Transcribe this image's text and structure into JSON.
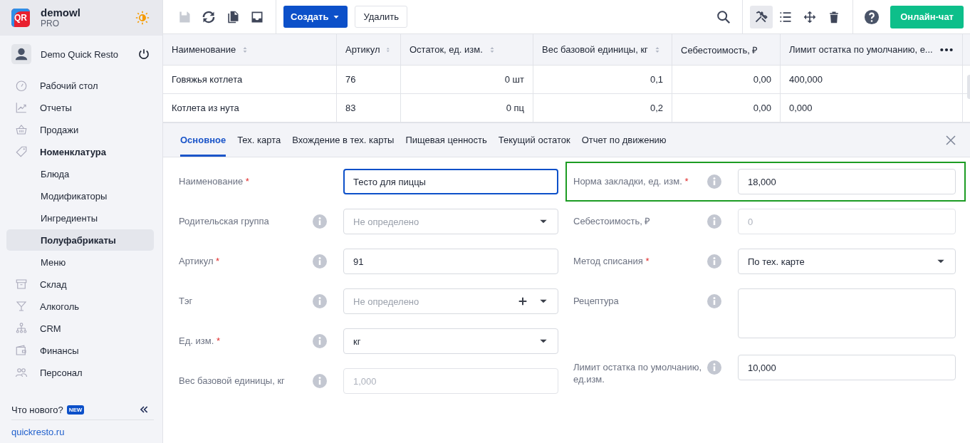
{
  "sidebar": {
    "logo_text": "QR",
    "account": {
      "name": "demowl",
      "plan": "PRO"
    },
    "user": {
      "name": "Demo Quick Resto"
    },
    "items": [
      {
        "label": "Рабочий стол",
        "selected": false,
        "expanded": false
      },
      {
        "label": "Отчеты",
        "selected": false,
        "expanded": false
      },
      {
        "label": "Продажи",
        "selected": false,
        "expanded": false
      },
      {
        "label": "Номенклатура",
        "selected": false,
        "expanded": true,
        "children": [
          {
            "label": "Блюда",
            "selected": false
          },
          {
            "label": "Модификаторы",
            "selected": false
          },
          {
            "label": "Ингредиенты",
            "selected": false
          },
          {
            "label": "Полуфабрикаты",
            "selected": true
          },
          {
            "label": "Меню",
            "selected": false
          }
        ]
      },
      {
        "label": "Склад",
        "selected": false,
        "expanded": false
      },
      {
        "label": "Алкоголь",
        "selected": false,
        "expanded": false
      },
      {
        "label": "CRM",
        "selected": false,
        "expanded": false
      },
      {
        "label": "Финансы",
        "selected": false,
        "expanded": false
      },
      {
        "label": "Персонал",
        "selected": false,
        "expanded": false
      }
    ],
    "whats_new": "Что нового?",
    "new_badge": "NEW",
    "site_link": "quickresto.ru"
  },
  "toolbar": {
    "left_icons": [
      {
        "kind": "save",
        "disabled": true
      },
      {
        "kind": "refresh",
        "disabled": false
      },
      {
        "kind": "copy",
        "disabled": false
      },
      {
        "kind": "inbox",
        "disabled": false
      }
    ],
    "create_button": "Создать",
    "delete_button": "Удалить",
    "right_icons": [
      {
        "kind": "tools",
        "selected": true
      },
      {
        "kind": "list",
        "selected": false
      },
      {
        "kind": "move",
        "selected": false
      },
      {
        "kind": "trash",
        "selected": false
      }
    ],
    "chat_button": "Онлайн-чат"
  },
  "table": {
    "columns": [
      {
        "label": "Наименование",
        "sortable": true
      },
      {
        "label": "Артикул",
        "sortable": true
      },
      {
        "label": "Остаток, ед. изм.",
        "sortable": true
      },
      {
        "label": "Вес базовой единицы, кг",
        "sortable": true
      },
      {
        "label": "Себестоимость, ₽",
        "sortable": false
      },
      {
        "label": "Лимит остатка по умолчанию, е...",
        "sortable": false
      }
    ],
    "rows": [
      [
        "Говяжья котлета",
        "76",
        "0 шт",
        "0,1",
        "0,00",
        "400,000"
      ],
      [
        "Котлета из нута",
        "83",
        "0 пц",
        "0,2",
        "0,00",
        "0,000"
      ]
    ]
  },
  "detail": {
    "required_mark": "*",
    "tabs": [
      {
        "label": "Основное",
        "selected": true
      },
      {
        "label": "Тех. карта",
        "selected": false
      },
      {
        "label": "Вхождение в тех. карты",
        "selected": false
      },
      {
        "label": "Пищевая ценность",
        "selected": false
      },
      {
        "label": "Текущий остаток",
        "selected": false
      },
      {
        "label": "Отчет по движению",
        "selected": false
      }
    ],
    "left_fields": [
      {
        "label": "Наименование",
        "kind": "input",
        "required": true,
        "info": false,
        "value": "Тесто для пиццы",
        "focused": true,
        "disabled": false
      },
      {
        "label": "Родительская группа",
        "kind": "select",
        "required": false,
        "info": true,
        "placeholder": "Не определено",
        "disabled": false
      },
      {
        "label": "Артикул",
        "kind": "input",
        "required": true,
        "info": true,
        "value": "91",
        "disabled": false
      },
      {
        "label": "Тэг",
        "kind": "select",
        "required": false,
        "info": true,
        "placeholder": "Не определено",
        "addable": true,
        "disabled": false
      },
      {
        "label": "Ед. изм.",
        "kind": "select",
        "required": true,
        "info": true,
        "value": "кг",
        "disabled": false
      },
      {
        "label": "Вес базовой единицы, кг",
        "kind": "input",
        "required": false,
        "info": true,
        "placeholder": "1,000",
        "disabled": true
      }
    ],
    "right_fields": [
      {
        "label": "Норма закладки, ед. изм.",
        "kind": "input",
        "required": true,
        "info": true,
        "value": "18,000",
        "highlighted": true,
        "disabled": false
      },
      {
        "label": "Себестоимость, ₽",
        "kind": "input",
        "required": false,
        "info": true,
        "placeholder": "0",
        "disabled": true
      },
      {
        "label": "Метод списания",
        "kind": "select",
        "required": true,
        "info": true,
        "value": "По тех. карте",
        "disabled": false
      },
      {
        "label": "Рецептура",
        "kind": "textarea",
        "required": false,
        "info": true,
        "disabled": false
      },
      {
        "label": "Лимит остатка по умолчанию, ед.изм.",
        "kind": "input",
        "required": false,
        "info": true,
        "value": "10,000",
        "disabled": false
      }
    ]
  }
}
